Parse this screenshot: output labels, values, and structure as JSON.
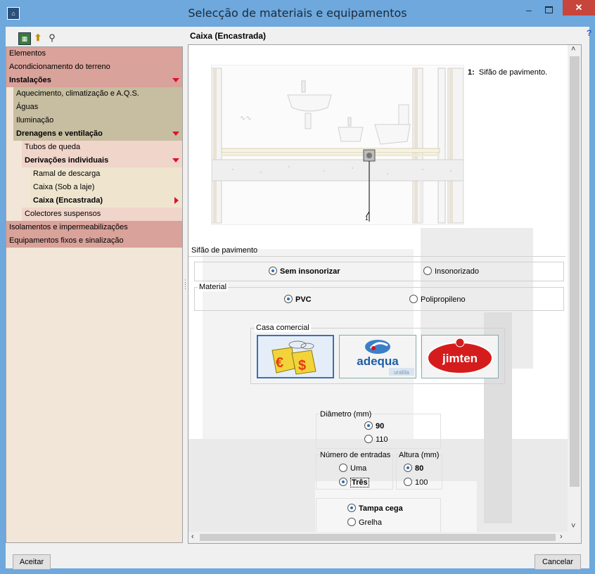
{
  "window": {
    "title": "Selecção de materiais e equipamentos",
    "minimize": "–",
    "close": "✕"
  },
  "toolbar": {
    "icons": [
      "mep-icon",
      "up-arrow-icon",
      "binoculars-icon"
    ]
  },
  "tree": {
    "items": [
      {
        "label": "Elementos",
        "level": 0,
        "bold": false
      },
      {
        "label": "Acondicionamento do terreno",
        "level": 0,
        "bold": false
      },
      {
        "label": "Instalações",
        "level": 0,
        "bold": true,
        "expanded": true
      },
      {
        "label": "Aquecimento, climatização e A.Q.S.",
        "level": 1,
        "bold": false
      },
      {
        "label": "Águas",
        "level": 1,
        "bold": false
      },
      {
        "label": "Iluminação",
        "level": 1,
        "bold": false
      },
      {
        "label": "Drenagens e ventilação",
        "level": 1,
        "bold": true,
        "expanded": true
      },
      {
        "label": "Tubos de queda",
        "level": 2,
        "bold": false
      },
      {
        "label": "Derivações individuais",
        "level": 2,
        "bold": true,
        "expanded": true
      },
      {
        "label": "Ramal de descarga",
        "level": 3,
        "bold": false
      },
      {
        "label": "Caixa (Sob a laje)",
        "level": 3,
        "bold": false
      },
      {
        "label": "Caixa (Encastrada)",
        "level": 3,
        "bold": true,
        "selected": true
      },
      {
        "label": "Colectores suspensos",
        "level": 2,
        "bold": false
      },
      {
        "label": "Isolamentos e impermeabilizações",
        "level": 0,
        "bold": false
      },
      {
        "label": "Equipamentos fixos e sinalização",
        "level": 0,
        "bold": false
      }
    ]
  },
  "panel": {
    "title": "Caixa (Encastrada)",
    "help": "?",
    "callout": {
      "num": "1:",
      "text": "Sifão de pavimento."
    },
    "section_label": "Sifão de pavimento",
    "insonorizar": {
      "options": [
        "Sem insonorizar",
        "Insonorizado"
      ],
      "selected": 0
    },
    "material": {
      "label": "Material",
      "options": [
        "PVC",
        "Polipropileno"
      ],
      "selected": 0
    },
    "casa_comercial": {
      "label": "Casa comercial",
      "brands": [
        {
          "name": "generic-price-icon",
          "text": "€ $"
        },
        {
          "name": "adequa-logo",
          "text": "adequa",
          "sub": "uralita"
        },
        {
          "name": "jimten-logo",
          "text": "jimten"
        }
      ],
      "selected": 0
    },
    "diametro": {
      "label": "Diâmetro (mm)",
      "options": [
        "90",
        "110"
      ],
      "selected": 0
    },
    "entradas": {
      "label": "Número de entradas",
      "options": [
        "Uma",
        "Três"
      ],
      "selected": 1
    },
    "altura": {
      "label": "Altura (mm)",
      "options": [
        "80",
        "100"
      ],
      "selected": 0
    },
    "tampa": {
      "options": [
        "Tampa cega",
        "Grelha"
      ],
      "selected": 0
    }
  },
  "buttons": {
    "accept": "Aceitar",
    "cancel": "Cancelar"
  },
  "colors": {
    "titlebar": "#6ea8dc",
    "close": "#c7453a",
    "accent": "#3c6fb3"
  }
}
